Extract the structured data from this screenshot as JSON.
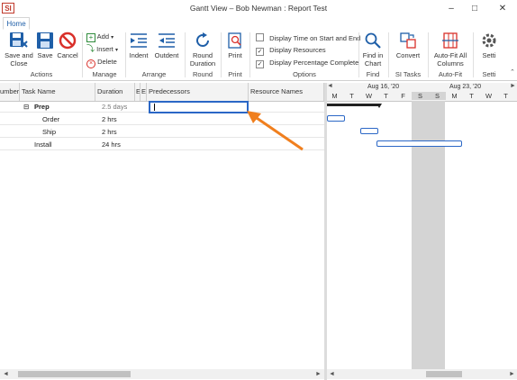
{
  "window": {
    "logo": "SI",
    "title": "Gantt View – Bob Newman : Report Test",
    "controls": [
      "–",
      "□",
      "✕"
    ]
  },
  "ribbon": {
    "tab": "Home",
    "actions": {
      "save_close": [
        "Save and",
        "Close"
      ],
      "save": "Save",
      "cancel": "Cancel",
      "group": "Actions"
    },
    "manage": {
      "add": "Add",
      "insert": "Insert",
      "delete": "Delete",
      "group": "Manage"
    },
    "arrange": {
      "indent": "Indent",
      "outdent": "Outdent",
      "group": "Arrange"
    },
    "round": {
      "button": [
        "Round",
        "Duration"
      ],
      "group": "Round"
    },
    "print": {
      "button": "Print",
      "group": "Print"
    },
    "print_preview_group": "",
    "options": {
      "time_start_end": "Display Time on Start and End",
      "display_resources": "Display Resources",
      "display_pct": "Display Percentage Complete",
      "time_checked": false,
      "resources_checked": true,
      "pct_checked": true,
      "group": "Options"
    },
    "find": {
      "button": [
        "Find in",
        "Chart"
      ],
      "group": "Find"
    },
    "si_tasks": {
      "button": "Convert",
      "group": "SI Tasks"
    },
    "autofit": {
      "button": [
        "Auto-Fit All",
        "Columns"
      ],
      "group": "Auto-Fit"
    },
    "settings": {
      "button": "Setti",
      "group": "Setti"
    }
  },
  "grid": {
    "columns": [
      "umber",
      "Task Name",
      "Duration",
      "ES",
      "EF",
      "Predecessors",
      "Resource Names"
    ],
    "rows": [
      {
        "name": "Prep",
        "duration": "2.5 days",
        "collapse": "⊟",
        "summary": true
      },
      {
        "name": "Order",
        "duration": "2 hrs",
        "summary": false
      },
      {
        "name": "Ship",
        "duration": "2 hrs",
        "summary": false
      },
      {
        "name": "Install",
        "duration": "24 hrs",
        "summary": false
      }
    ],
    "editing_cell_value": ""
  },
  "gantt": {
    "weeks": [
      "Aug 16, '20",
      "Aug 23, '20"
    ],
    "days": [
      "M",
      "T",
      "W",
      "T",
      "F",
      "S",
      "S",
      "M",
      "T",
      "W",
      "T"
    ],
    "nav_left": "◄",
    "nav_right": "►"
  },
  "annotation": {
    "arrow_color": "#f07f1e"
  },
  "colors": {
    "accent": "#1f5fa8",
    "cancel_red": "#d9302a",
    "highlight_box": "#2b67c6"
  }
}
